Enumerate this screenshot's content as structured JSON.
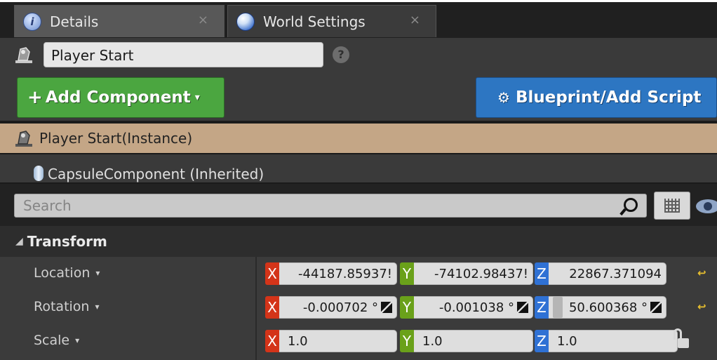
{
  "tabs": [
    {
      "label": "Details",
      "icon": "info-icon",
      "close": "×"
    },
    {
      "label": "World Settings",
      "icon": "globe-icon",
      "close": "×"
    }
  ],
  "actor": {
    "name": "Player Start",
    "help": "?"
  },
  "buttons": {
    "add_component": {
      "plus": "+",
      "label": "Add Component",
      "caret": "▾"
    },
    "blueprint": {
      "icon": "⚙",
      "label": "Blueprint/Add Script"
    }
  },
  "tree": {
    "selected": "Player Start(Instance)",
    "child": "CapsuleComponent (Inherited)"
  },
  "search": {
    "placeholder": "Search"
  },
  "transform": {
    "title": "Transform",
    "arrow": "◢",
    "rows": [
      {
        "label": "Location",
        "caret": "▾",
        "x": "-44187.85937!",
        "y": "-74102.98437!",
        "z": "22867.371094",
        "reset": "↩"
      },
      {
        "label": "Rotation",
        "caret": "▾",
        "x": "-0.000702 °",
        "y": "-0.001038 °",
        "z": "50.600368 °",
        "reset": "↩"
      },
      {
        "label": "Scale",
        "caret": "▾",
        "x": "1.0",
        "y": "1.0",
        "z": "1.0"
      }
    ],
    "axis_letters": {
      "x": "X",
      "y": "Y",
      "z": "Z"
    }
  },
  "colors": {
    "add_button": "#4ba640",
    "blueprint_button": "#2d76c2",
    "selection": "#c4a686",
    "axis_x": "#d43419",
    "axis_y": "#6aa11a",
    "axis_z": "#2f71d4",
    "reset": "#e9c02f"
  }
}
